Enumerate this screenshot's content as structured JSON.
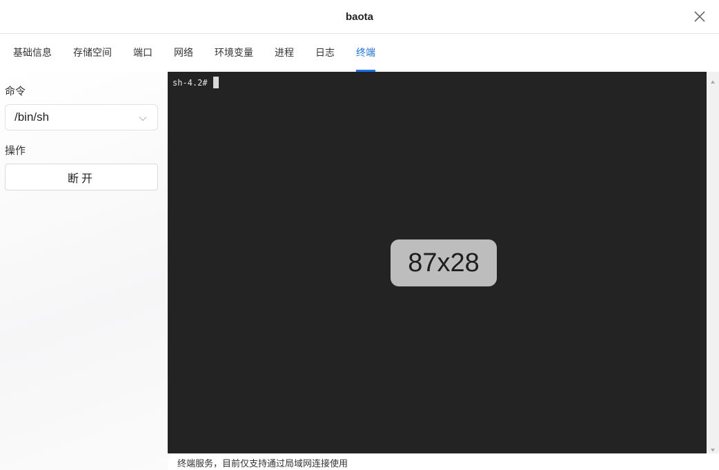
{
  "window": {
    "title": "baota"
  },
  "tabs": [
    {
      "label": "基础信息",
      "active": false
    },
    {
      "label": "存储空间",
      "active": false
    },
    {
      "label": "端口",
      "active": false
    },
    {
      "label": "网络",
      "active": false
    },
    {
      "label": "环境变量",
      "active": false
    },
    {
      "label": "进程",
      "active": false
    },
    {
      "label": "日志",
      "active": false
    },
    {
      "label": "终端",
      "active": true
    }
  ],
  "sidebar": {
    "command_label": "命令",
    "command_value": "/bin/sh",
    "action_label": "操作",
    "disconnect_label": "断开"
  },
  "terminal": {
    "prompt": "sh-4.2#",
    "size_overlay": "87x28"
  },
  "footer": {
    "note": "终端服务，目前仅支持通过局域网连接使用"
  },
  "colors": {
    "accent": "#1a73e8",
    "terminal_bg": "#232323",
    "overlay_bg": "#bdbdbd"
  },
  "icons": {
    "close": "close-icon",
    "dropdown": "chevron-down-icon",
    "scroll_up": "triangle-up-icon",
    "scroll_down": "triangle-down-icon"
  }
}
